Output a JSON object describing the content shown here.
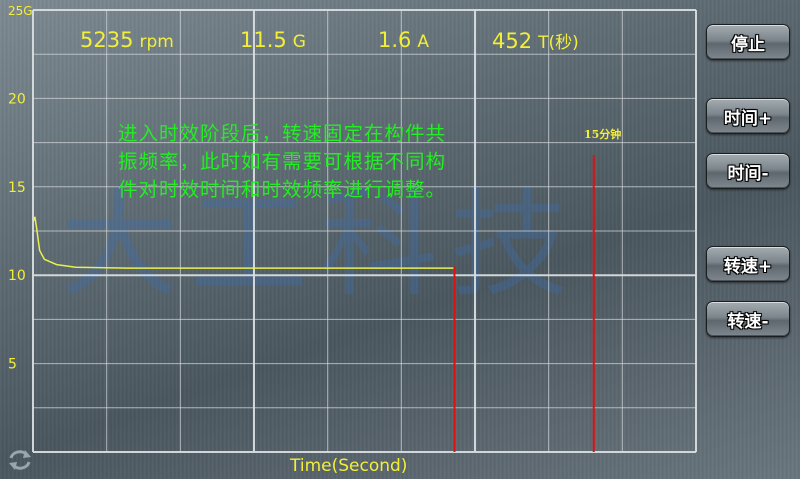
{
  "readouts": {
    "speed": {
      "value": "5235",
      "unit": "rpm"
    },
    "accel": {
      "value": "11.5",
      "unit": "G"
    },
    "current": {
      "value": "1.6",
      "unit": "A"
    },
    "time": {
      "value": "452",
      "unit": "T(秒)"
    }
  },
  "note": "进入时效阶段后，转速固定在构件共振频率，此时如有需要可根据不同构件对时效时间和时效频率进行调整。",
  "marker": {
    "label": "15分钟"
  },
  "watermark": "大工科技",
  "buttons": {
    "stop": "停止",
    "time_plus": "时间+",
    "time_minus": "时间-",
    "speed_plus": "转速+",
    "speed_minus": "转速-"
  },
  "icons": {
    "refresh": "refresh-icon"
  },
  "colors": {
    "curve": "#e8ef50",
    "readout": "#f2ee3a",
    "note": "#22ee22",
    "marker_line": "#e01010",
    "grid": "#d8dde0"
  },
  "chart_data": {
    "type": "line",
    "xlabel": "Time(Second)",
    "ylabel": "",
    "ylim": [
      0,
      25
    ],
    "y_ticks": [
      "5",
      "10",
      "15",
      "20",
      "25G"
    ],
    "grid": true,
    "series": [
      {
        "x": [
          0,
          2,
          4,
          7,
          12,
          25,
          45,
          100,
          200,
          300,
          420,
          445
        ],
        "y": [
          13.0,
          13.3,
          12.6,
          11.4,
          10.9,
          10.6,
          10.45,
          10.4,
          10.4,
          10.4,
          10.4,
          10.4
        ]
      }
    ],
    "xlim": [
      0,
      700
    ],
    "markers": [
      {
        "x": 445,
        "y_from": 0,
        "y_to": 10.5
      },
      {
        "x": 592,
        "y_from": 0,
        "y_to": 16.8
      }
    ]
  }
}
